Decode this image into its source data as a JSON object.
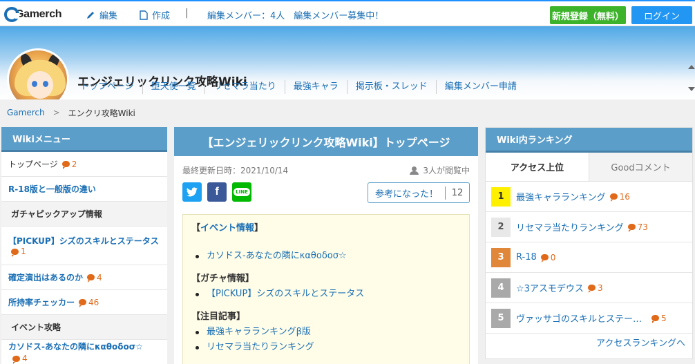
{
  "topbar": {
    "logo": "Gamerch",
    "edit_label": "編集",
    "create_label": "作成",
    "separator": "|",
    "members_text": "編集メンバー：4人　編集メンバー募集中！",
    "register_label": "新規登録（無料）",
    "login_label": "ログイン"
  },
  "header": {
    "site_title": "エンジェリックリンク攻略Wiki",
    "nav": [
      "トップページ",
      "堕天使一覧",
      "リセマラ当たり",
      "最強キャラ",
      "掲示板・スレッド",
      "編集メンバー申請"
    ]
  },
  "breadcrumb": {
    "root": "Gamerch",
    "separator": ">",
    "current": "エンクリ攻略Wiki"
  },
  "left_menu": {
    "title": "Wikiメニュー",
    "items": [
      {
        "label": "トップページ",
        "comments": "2"
      },
      {
        "label": "R-18版と一般版の違い"
      },
      {
        "label": "ガチャピックアップ情報"
      },
      {
        "label": "【PICKUP】シズのスキルとステータス",
        "comments": "1"
      },
      {
        "label": "確定演出はあるのか",
        "comments": "4"
      },
      {
        "label": "所持率チェッカー",
        "comments": "46"
      },
      {
        "label": "イベント攻略"
      },
      {
        "label": "カソドス-あなたの隣にκαθοδοσ☆",
        "comments": "4"
      }
    ]
  },
  "article": {
    "title": "【エンジェリックリンク攻略Wiki】トップページ",
    "last_updated": "最終更新日時：2021/10/14",
    "viewers": "3人が閲覧中",
    "share": {
      "facebook": "f",
      "line": "LINE"
    },
    "helpful_label": "参考になった！",
    "helpful_count": "12",
    "sections": [
      {
        "heading_prefix": "【",
        "heading_link": "イベント情報",
        "heading_suffix": "】",
        "items": [
          "カソドス-あなたの隣にκαθοδοσ☆"
        ]
      },
      {
        "heading": "【ガチャ情報】",
        "items": [
          "【PICKUP】シズのスキルとステータス"
        ]
      },
      {
        "heading": "【注目記事】",
        "items": [
          "最強キャラランキングβ版",
          "リセマラ当たりランキング"
        ]
      }
    ]
  },
  "ranking": {
    "title": "Wiki内ランキング",
    "tab_access": "アクセス上位",
    "tab_good": "Goodコメント",
    "items": [
      {
        "rank": "1",
        "title": "最強キャラランキング",
        "comments": "16",
        "badge_color": "#fff000",
        "badge_text_color": "#333333"
      },
      {
        "rank": "2",
        "title": "リセマラ当たりランキング",
        "comments": "73",
        "badge_color": "#e8e8e8",
        "badge_text_color": "#555555"
      },
      {
        "rank": "3",
        "title": "R-18",
        "comments": "0",
        "badge_color": "#e0873a",
        "badge_text_color": "#ffffff"
      },
      {
        "rank": "4",
        "title": "☆3アスモデウス",
        "comments": "3",
        "badge_color": "#a9a9a9",
        "badge_text_color": "#ffffff"
      },
      {
        "rank": "5",
        "title": "ヴァッサゴのスキルとステー…",
        "comments": "5",
        "badge_color": "#a9a9a9",
        "badge_text_color": "#ffffff"
      }
    ],
    "more_label": "アクセスランキングへ"
  }
}
